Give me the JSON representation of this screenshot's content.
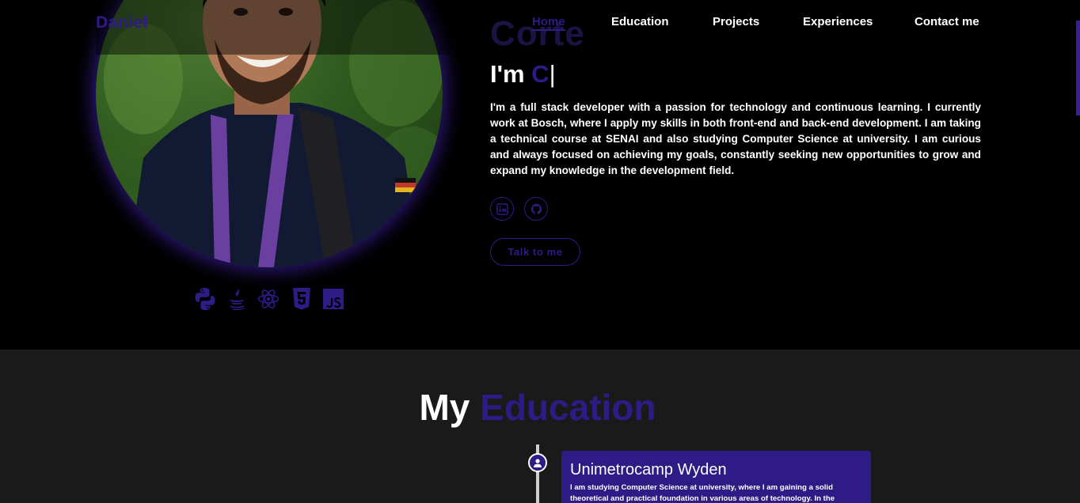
{
  "header": {
    "brand": "Daniel",
    "nav": [
      {
        "label": "Home",
        "active": true
      },
      {
        "label": "Education",
        "active": false
      },
      {
        "label": "Projects",
        "active": false
      },
      {
        "label": "Experiences",
        "active": false
      },
      {
        "label": "Contact me",
        "active": false
      }
    ]
  },
  "hero": {
    "name_line": "Corte",
    "greeting_prefix": "I'm ",
    "greeting_typed": "C",
    "caret": "|",
    "bio": "I'm a full stack developer with a passion for technology and continuous learning. I currently work at Bosch, where I apply my skills in both front-end and back-end development. I am taking a technical course at SENAI and also studying Computer Science at university. I am curious and always focused on achieving my goals, constantly seeking new opportunities to grow and expand my knowledge in the development field.",
    "social": [
      {
        "icon": "linkedin-icon"
      },
      {
        "icon": "github-icon"
      }
    ],
    "cta_label": "Talk to me",
    "tech_icons": [
      "python-icon",
      "java-icon",
      "react-icon",
      "html5-icon",
      "javascript-icon"
    ]
  },
  "education": {
    "title_prefix": "My ",
    "title_accent": "Education",
    "items": [
      {
        "title": "Unimetrocamp Wyden",
        "text": "I am studying Computer Science at university, where I am gaining a solid theoretical and practical foundation in various areas of technology. In the"
      }
    ]
  },
  "colors": {
    "accent": "#2e1b86",
    "background": "#000000",
    "section_background": "#1a1a1a"
  }
}
